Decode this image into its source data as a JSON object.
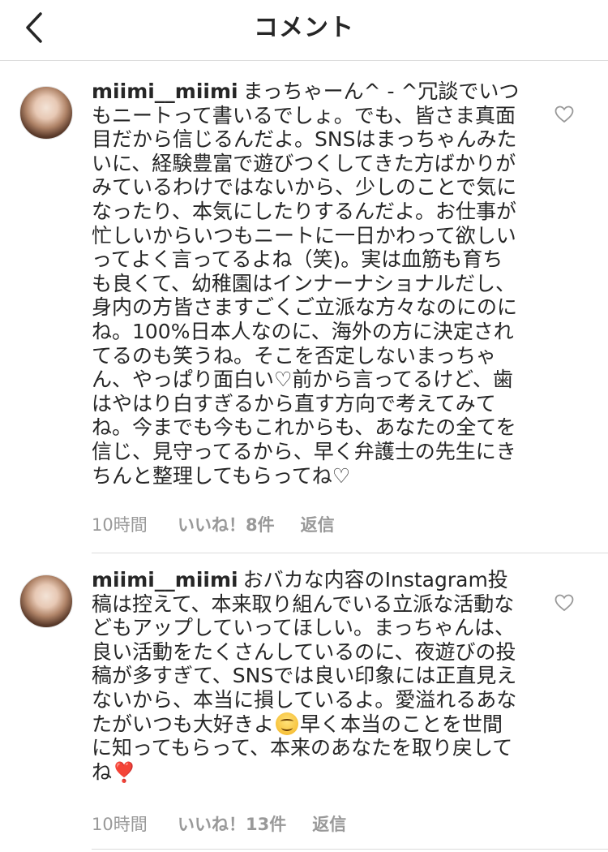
{
  "header": {
    "title": "コメント",
    "back_icon": "chevron-left-icon"
  },
  "comments": [
    {
      "username": "miimi__miimi",
      "text": "まっちゃーん^ - ^冗談でいつもニートって書いるでしょ。でも、皆さま真面目だから信じるんだよ。SNSはまっちゃんみたいに、経験豊富で遊びつくしてきた方ばかりがみているわけではないから、少しのことで気になったり、本気にしたりするんだよ。お仕事が忙しいからいつもニートに一日かわって欲しいってよく言ってるよね（笑)。実は血筋も育ちも良くて、幼稚園はインナーナショナルだし、身内の方皆さますごくご立派な方々なのにのにね。100%日本人なのに、海外の方に決定されてるのも笑うね。そこを否定しないまっちゃん、やっぱり面白い♡前から言ってるけど、歯はやはり白すぎるから直す方向で考えてみてね。今までも今もこれからも、あなたの全てを信じ、見守ってるから、早く弁護士の先生にきちんと整理してもらってね♡",
      "time": "10時間",
      "likes": "いいね！8件",
      "reply": "返信"
    },
    {
      "username": "miimi__miimi",
      "text_before_emoji": "おバカな内容のInstagram投稿は控えて、本来取り組んでいる立派な活動などもアップしていってほしい。まっちゃんは、良い活動をたくさんしているのに、夜遊びの投稿が多すぎて、SNSでは良い印象には正直見えないから、本当に損しているよ。愛溢れるあなたがいつも大好きよ",
      "emoji_1": "smiling-face-emoji",
      "text_after_emoji": "早く本当のことを世間に知ってもらって、本来のあなたを取り戻してね",
      "emoji_2_char": "❣️",
      "time": "10時間",
      "likes": "いいね！13件",
      "reply": "返信"
    }
  ],
  "colors": {
    "text": "#262626",
    "meta": "#999999",
    "divider": "#dbdbdb",
    "heart_outline": "#999999"
  }
}
